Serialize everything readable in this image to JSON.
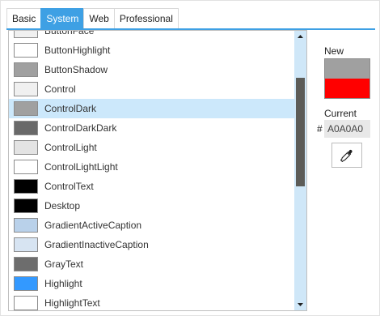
{
  "tabs": [
    {
      "label": "Basic"
    },
    {
      "label": "System"
    },
    {
      "label": "Web"
    },
    {
      "label": "Professional"
    }
  ],
  "selected_tab": "System",
  "colors": [
    {
      "label": "ButtonFace",
      "color": "#f0f0f0"
    },
    {
      "label": "ButtonHighlight",
      "color": "#ffffff"
    },
    {
      "label": "ButtonShadow",
      "color": "#a0a0a0"
    },
    {
      "label": "Control",
      "color": "#f0f0f0"
    },
    {
      "label": "ControlDark",
      "color": "#a0a0a0",
      "selected": true
    },
    {
      "label": "ControlDarkDark",
      "color": "#696969"
    },
    {
      "label": "ControlLight",
      "color": "#e3e3e3"
    },
    {
      "label": "ControlLightLight",
      "color": "#ffffff"
    },
    {
      "label": "ControlText",
      "color": "#000000"
    },
    {
      "label": "Desktop",
      "color": "#000000"
    },
    {
      "label": "GradientActiveCaption",
      "color": "#b9d1ea"
    },
    {
      "label": "GradientInactiveCaption",
      "color": "#d7e4f2"
    },
    {
      "label": "GrayText",
      "color": "#6d6d6d"
    },
    {
      "label": "Highlight",
      "color": "#3399ff"
    },
    {
      "label": "HighlightText",
      "color": "#ffffff"
    }
  ],
  "preview": {
    "new_label": "New",
    "current_label": "Current",
    "new_color": "#a0a0a0",
    "current_color": "#ff0000",
    "hash": "#",
    "hex_value": "A0A0A0"
  },
  "icons": {
    "eyedropper": "eyedropper-icon",
    "scroll_up": "arrow-up-icon",
    "scroll_down": "arrow-down-icon"
  },
  "scroll": {
    "thumb_color": "#5c5c58",
    "track_color": "#cfe7f8"
  }
}
